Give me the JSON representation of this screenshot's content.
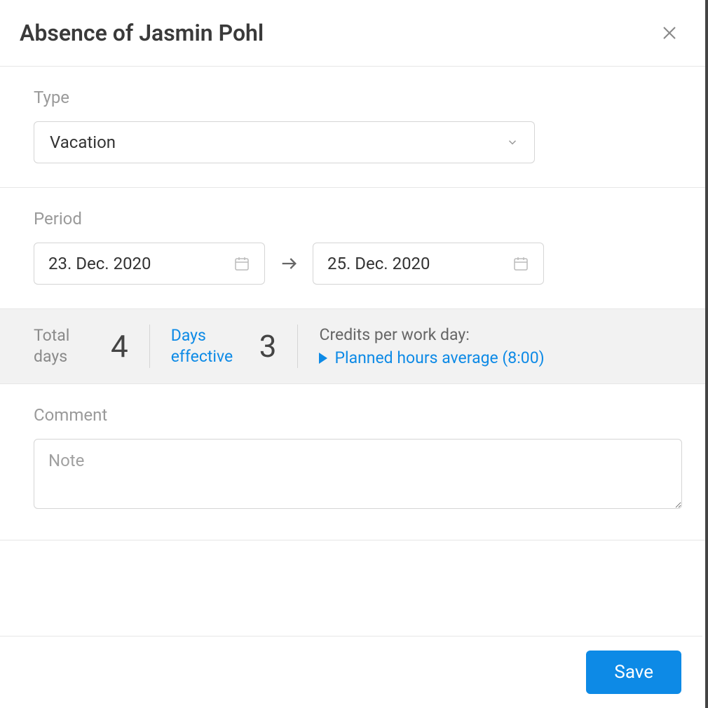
{
  "header": {
    "title": "Absence of Jasmin Pohl"
  },
  "type_section": {
    "label": "Type",
    "selected": "Vacation"
  },
  "period_section": {
    "label": "Period",
    "start_date": "23. Dec. 2020",
    "end_date": "25. Dec. 2020"
  },
  "stats": {
    "total_days_label": "Total days",
    "total_days_value": "4",
    "days_effective_label": "Days effective",
    "days_effective_value": "3",
    "credits_label": "Credits per work day:",
    "credits_link": "Planned hours average (8:00)"
  },
  "comment_section": {
    "label": "Comment",
    "placeholder": "Note"
  },
  "footer": {
    "save_label": "Save"
  }
}
